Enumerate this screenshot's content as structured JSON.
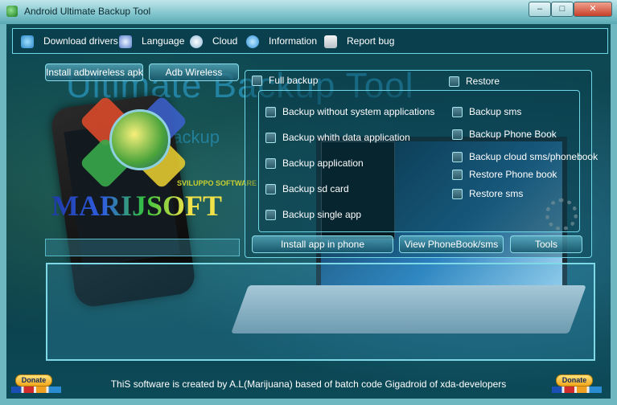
{
  "window": {
    "title": "Android Ultimate Backup Tool",
    "min_label": "–",
    "max_label": "□",
    "close_label": "✕"
  },
  "menu": {
    "items": [
      {
        "label": "Download drivers",
        "icon": "android-icon"
      },
      {
        "label": "Language",
        "icon": "language-icon"
      },
      {
        "label": "Cloud",
        "icon": "cloud-icon"
      },
      {
        "label": "Information",
        "icon": "info-icon"
      },
      {
        "label": "Report bug",
        "icon": "report-bug-icon"
      }
    ]
  },
  "background": {
    "title": "Ultimate Backup Tool",
    "subtitle": "Full Backup",
    "logo_text": "MARIJSOFT",
    "logo_tagline": "SVILUPPO SOFTWARE"
  },
  "buttons": {
    "install_adbwireless": "Install adbwireless apk",
    "adb_wireless": "Adb Wireless",
    "install_app": "Install app in phone",
    "view_phonebook": "View PhoneBook/sms",
    "tools": "Tools"
  },
  "options": {
    "full_backup": "Full backup",
    "restore": "Restore",
    "backup_items": [
      "Backup without system applications",
      "Backup whith data application",
      "Backup application",
      "Backup sd card",
      "Backup single app"
    ],
    "right_items": [
      "Backup sms",
      "Backup Phone Book",
      "Backup cloud sms/phonebook",
      "Restore Phone book",
      "Restore sms"
    ]
  },
  "footer": {
    "credit": "ThiS software is created by A.L(Marijuana) based of batch code Gigadroid of xda-developers",
    "donate_label": "Donate"
  },
  "colors": {
    "accent": "#6fd6e6",
    "window_bg": "#0b3b44"
  }
}
